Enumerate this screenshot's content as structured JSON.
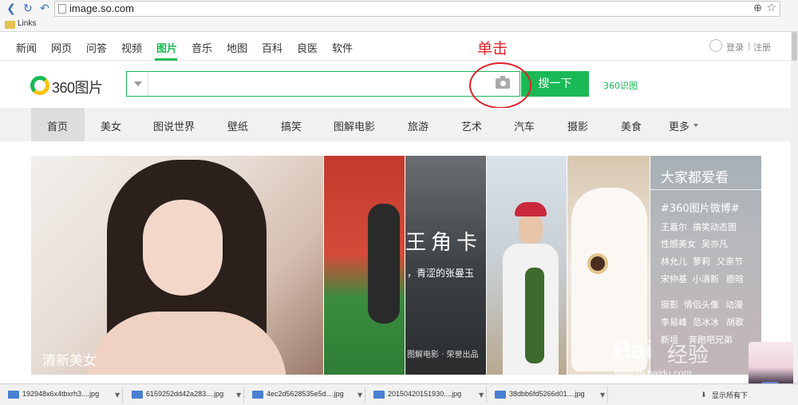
{
  "browser": {
    "url": "image.so.com",
    "bookmark_folder": "Links"
  },
  "topnav": {
    "items": [
      "新闻",
      "网页",
      "问答",
      "视频",
      "图片",
      "音乐",
      "地图",
      "百科",
      "良医",
      "软件"
    ],
    "active": "图片",
    "login": "登录",
    "separator": "|",
    "register": "注册"
  },
  "annotation": "单击",
  "logo_text": "360图片",
  "search": {
    "value": "",
    "button": "搜一下",
    "shitu_link": "360识图"
  },
  "categories": [
    "首页",
    "美女",
    "图说世界",
    "壁纸",
    "搞笑",
    "图解电影",
    "旅游",
    "艺术",
    "汽车",
    "摄影",
    "美食",
    "更多"
  ],
  "active_category": "首页",
  "tiles": {
    "main_caption": "清新美女",
    "movie_title": "王角卡",
    "movie_subtitle": "，青涩的张曼玉",
    "movie_credit": "图解电影 · 荣誉出品"
  },
  "sidebar": {
    "title": "大家都爱看",
    "hashtag": "#360图片微博#",
    "tags": [
      [
        "王嘉尔",
        "搞笑动态图"
      ],
      [
        "性感美女",
        "吴亦凡"
      ],
      [
        "林允儿",
        "萝莉",
        "父亲节"
      ],
      [
        "宋仲基",
        "小清新",
        "鹿晗"
      ],
      [
        "摄影",
        "情侣头像",
        "动漫"
      ],
      [
        "李易峰",
        "范冰冰",
        "胡歌"
      ],
      [
        "新垣",
        "奔跑吧兄弟"
      ]
    ]
  },
  "watermark": {
    "text": "Bai",
    "text2": "经验",
    "sub": "jingyan.baidu.com"
  },
  "downloads": {
    "files": [
      "192948x6x4tbxrh3....jpg",
      "6159252dd42a283....jpg",
      "4ec2d5628535e5d....jpg",
      "20150420151930....jpg",
      "38dbb6fd5266d01....jpg"
    ],
    "show_all": "显示所有下"
  },
  "colors": {
    "accent": "#19b955",
    "annotation": "#e0212a"
  }
}
